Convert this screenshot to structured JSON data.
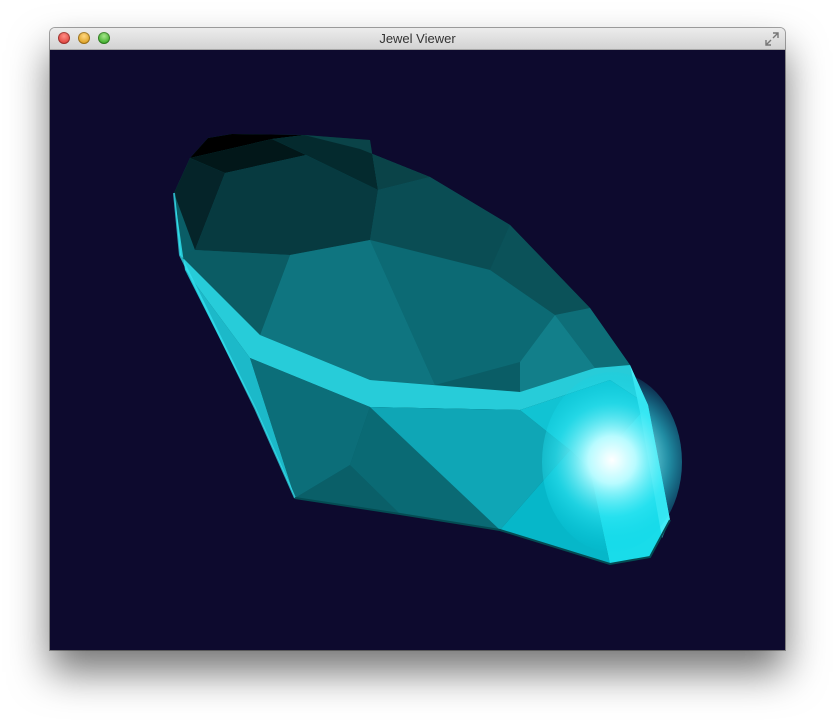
{
  "window": {
    "title": "Jewel Viewer",
    "controls": [
      "close-icon",
      "minimize-icon",
      "zoom-icon",
      "fullscreen-icon"
    ]
  },
  "viewport": {
    "background": "#0d0a2e",
    "jewel_color": "#00d4e8",
    "highlight_color": "#ffffff"
  }
}
